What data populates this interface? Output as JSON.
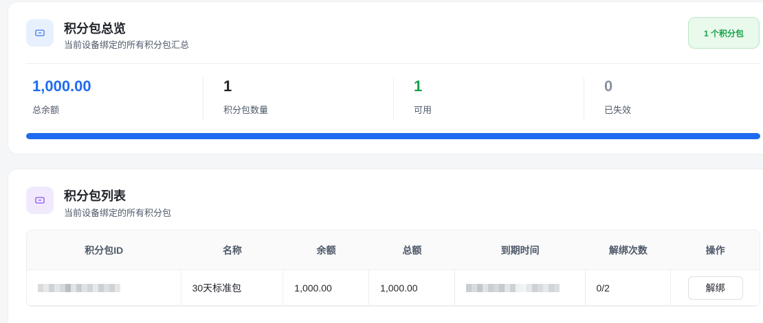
{
  "overview": {
    "title": "积分包总览",
    "subtitle": "当前设备绑定的所有积分包汇总",
    "badge": "1 个积分包",
    "stats": [
      {
        "value": "1,000.00",
        "label": "总余额",
        "color": "#1f6bf0"
      },
      {
        "value": "1",
        "label": "积分包数量",
        "color": "#1f2329"
      },
      {
        "value": "1",
        "label": "可用",
        "color": "#16a34a"
      },
      {
        "value": "0",
        "label": "已失效",
        "color": "#8a919f"
      }
    ],
    "progress": 1.0
  },
  "list": {
    "title": "积分包列表",
    "subtitle": "当前设备绑定的所有积分包",
    "columns": [
      "积分包ID",
      "名称",
      "余额",
      "总额",
      "到期时间",
      "解绑次数",
      "操作"
    ],
    "rows": [
      {
        "name": "30天标准包",
        "balance": "1,000.00",
        "total": "1,000.00",
        "unbind_count": "0/2",
        "action": "解绑"
      }
    ]
  },
  "colors": {
    "accent": "#1f6bf0",
    "success": "#16a34a",
    "muted": "#8a919f"
  }
}
